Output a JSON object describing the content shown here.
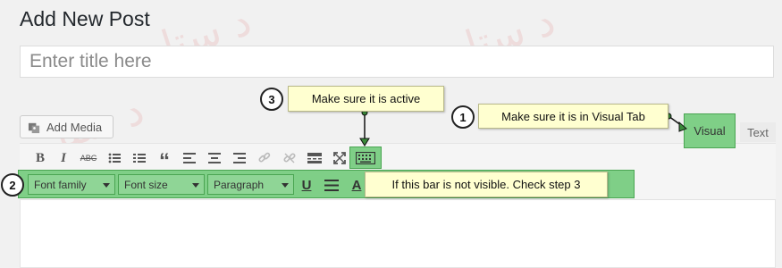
{
  "page": {
    "title": "Add New Post"
  },
  "title_input": {
    "placeholder": "Enter title here"
  },
  "media": {
    "add_media_label": "Add Media"
  },
  "tabs": {
    "visual": "Visual",
    "text": "Text"
  },
  "toolbar_row1": [
    {
      "name": "bold-button",
      "icon": "B"
    },
    {
      "name": "italic-button",
      "icon": "I"
    },
    {
      "name": "strikethrough-button",
      "icon": "ABC"
    },
    {
      "name": "bulleted-list-button",
      "icon": "list-ul-icon"
    },
    {
      "name": "numbered-list-button",
      "icon": "list-ol-icon"
    },
    {
      "name": "blockquote-button",
      "icon": "“"
    },
    {
      "name": "align-left-button",
      "icon": "align-left-icon"
    },
    {
      "name": "align-center-button",
      "icon": "align-center-icon"
    },
    {
      "name": "align-right-button",
      "icon": "align-right-icon"
    },
    {
      "name": "insert-link-button",
      "icon": "link-icon"
    },
    {
      "name": "remove-link-button",
      "icon": "unlink-icon"
    },
    {
      "name": "read-more-button",
      "icon": "more-icon"
    },
    {
      "name": "fullscreen-button",
      "icon": "fullscreen-icon"
    },
    {
      "name": "toolbar-toggle-button",
      "icon": "keyboard-icon"
    }
  ],
  "toolbar_row2": {
    "font_family": "Font family",
    "font_size": "Font size",
    "paragraph": "Paragraph",
    "underline_icon": "U",
    "justify_icon": "justify-icon",
    "text_color_icon": "A"
  },
  "callouts": {
    "step1": {
      "number": "1",
      "text": "Make sure it is in Visual Tab"
    },
    "step2": {
      "number": "2",
      "text": "If this bar is not visible. Check step 3"
    },
    "step3": {
      "number": "3",
      "text": "Make sure it is active"
    }
  },
  "colors": {
    "highlight": "#7fcf87",
    "callout_bg": "#ffffd0"
  }
}
